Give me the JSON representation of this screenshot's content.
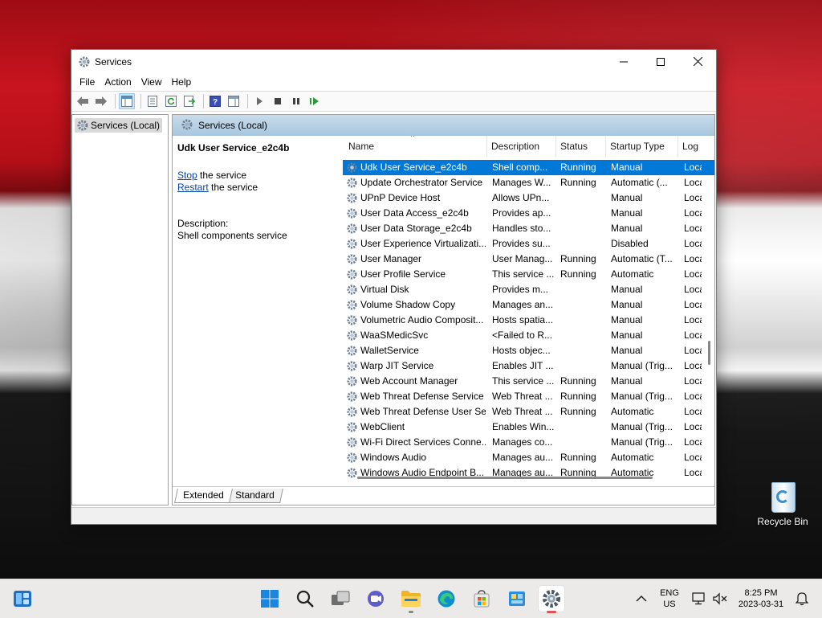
{
  "desktop": {
    "recycle_bin_label": "Recycle Bin"
  },
  "window": {
    "title": "Services",
    "minimize_icon": "minimize-icon",
    "maximize_icon": "maximize-icon",
    "close_icon": "close-icon"
  },
  "menu": [
    "File",
    "Action",
    "Help",
    "View"
  ],
  "menu_items": {
    "file": "File",
    "action": "Action",
    "view": "View",
    "help": "Help"
  },
  "tree": {
    "root_label": "Services (Local)"
  },
  "pane": {
    "header": "Services (Local)",
    "selected_service": "Udk User Service_e2c4b",
    "stop_link": "Stop",
    "stop_suffix": " the service",
    "restart_link": "Restart",
    "restart_suffix": " the service",
    "description_label": "Description:",
    "description_text": "Shell components service"
  },
  "columns": {
    "name": "Name",
    "description": "Description",
    "status": "Status",
    "startup_type": "Startup Type",
    "log_on_as": "Log"
  },
  "rows": [
    {
      "name": "Udk User Service_e2c4b",
      "description": "Shell comp...",
      "status": "Running",
      "startup": "Manual",
      "logon": "Loca",
      "selected": true
    },
    {
      "name": "Update Orchestrator Service",
      "description": "Manages W...",
      "status": "Running",
      "startup": "Automatic (...",
      "logon": "Loca"
    },
    {
      "name": "UPnP Device Host",
      "description": "Allows UPn...",
      "status": "",
      "startup": "Manual",
      "logon": "Loca"
    },
    {
      "name": "User Data Access_e2c4b",
      "description": "Provides ap...",
      "status": "",
      "startup": "Manual",
      "logon": "Loca"
    },
    {
      "name": "User Data Storage_e2c4b",
      "description": "Handles sto...",
      "status": "",
      "startup": "Manual",
      "logon": "Loca"
    },
    {
      "name": "User Experience Virtualizati...",
      "description": "Provides su...",
      "status": "",
      "startup": "Disabled",
      "logon": "Loca"
    },
    {
      "name": "User Manager",
      "description": "User Manag...",
      "status": "Running",
      "startup": "Automatic (T...",
      "logon": "Loca"
    },
    {
      "name": "User Profile Service",
      "description": "This service ...",
      "status": "Running",
      "startup": "Automatic",
      "logon": "Loca"
    },
    {
      "name": "Virtual Disk",
      "description": "Provides m...",
      "status": "",
      "startup": "Manual",
      "logon": "Loca"
    },
    {
      "name": "Volume Shadow Copy",
      "description": "Manages an...",
      "status": "",
      "startup": "Manual",
      "logon": "Loca"
    },
    {
      "name": "Volumetric Audio Composit...",
      "description": "Hosts spatia...",
      "status": "",
      "startup": "Manual",
      "logon": "Loca"
    },
    {
      "name": "WaaSMedicSvc",
      "description": "<Failed to R...",
      "status": "",
      "startup": "Manual",
      "logon": "Loca"
    },
    {
      "name": "WalletService",
      "description": "Hosts objec...",
      "status": "",
      "startup": "Manual",
      "logon": "Loca"
    },
    {
      "name": "Warp JIT Service",
      "description": "Enables JIT ...",
      "status": "",
      "startup": "Manual (Trig...",
      "logon": "Loca"
    },
    {
      "name": "Web Account Manager",
      "description": "This service ...",
      "status": "Running",
      "startup": "Manual",
      "logon": "Loca"
    },
    {
      "name": "Web Threat Defense Service",
      "description": "Web Threat ...",
      "status": "Running",
      "startup": "Manual (Trig...",
      "logon": "Loca"
    },
    {
      "name": "Web Threat Defense User Se...",
      "description": "Web Threat ...",
      "status": "Running",
      "startup": "Automatic",
      "logon": "Loca"
    },
    {
      "name": "WebClient",
      "description": "Enables Win...",
      "status": "",
      "startup": "Manual (Trig...",
      "logon": "Loca"
    },
    {
      "name": "Wi-Fi Direct Services Conne...",
      "description": "Manages co...",
      "status": "",
      "startup": "Manual (Trig...",
      "logon": "Loca"
    },
    {
      "name": "Windows Audio",
      "description": "Manages au...",
      "status": "Running",
      "startup": "Automatic",
      "logon": "Loca"
    },
    {
      "name": "Windows Audio Endpoint B...",
      "description": "Manages au...",
      "status": "Running",
      "startup": "Automatic",
      "logon": "Loca"
    }
  ],
  "tabs": {
    "extended": "Extended",
    "standard": "Standard"
  },
  "taskbar": {
    "lang_line1": "ENG",
    "lang_line2": "US",
    "time": "8:25 PM",
    "date": "2023-03-31"
  },
  "colors": {
    "selection": "#0078d7",
    "link": "#0645ad",
    "header_band": "#b5cfe3"
  }
}
